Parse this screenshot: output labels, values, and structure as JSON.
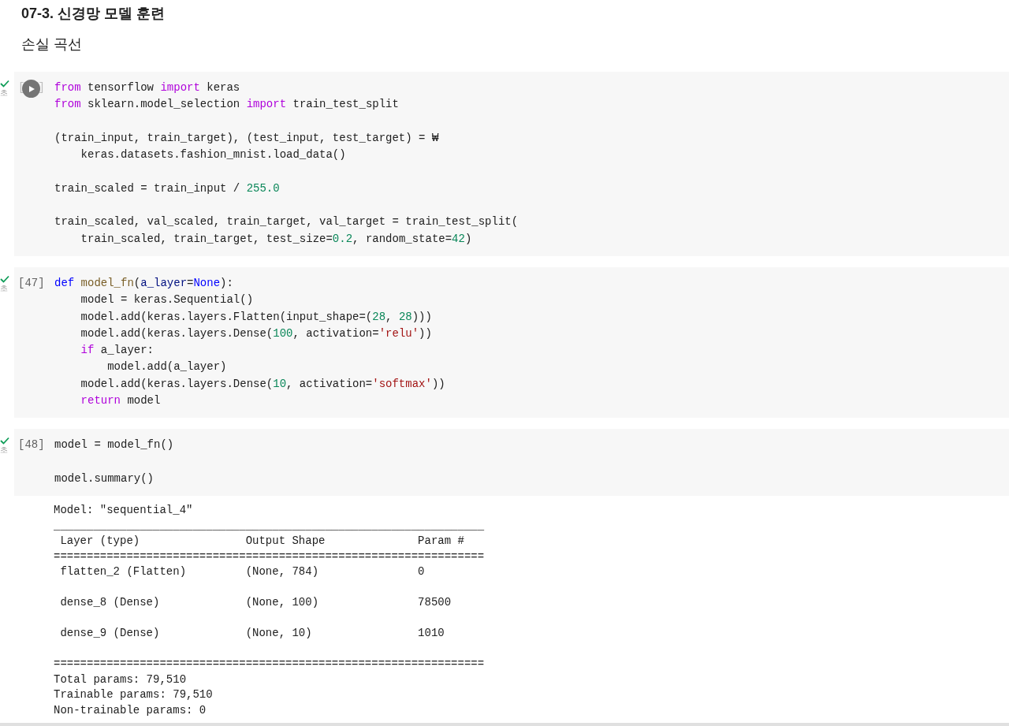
{
  "heading": "07-3. 신경망 모델 훈련",
  "subheading": "손실 곡선",
  "cells": [
    {
      "completed": true,
      "time": "초",
      "hover_run": true,
      "prompt_open": "[",
      "prompt_close": "]",
      "blocks": [
        [
          {
            "tokens": [
              {
                "text": "from",
                "kind": "keyword"
              },
              {
                "text": " tensorflow "
              },
              {
                "text": "import",
                "kind": "keyword"
              },
              {
                "text": " keras"
              }
            ]
          },
          {
            "tokens": [
              {
                "text": "from",
                "kind": "keyword"
              },
              {
                "text": " sklearn.model_selection "
              },
              {
                "text": "import",
                "kind": "keyword"
              },
              {
                "text": " train_test_split"
              }
            ]
          }
        ],
        [
          {
            "tokens": [
              {
                "text": "(train_input, train_target), (test_input, test_target) = ₩"
              }
            ],
            "children": [
              {
                "tokens": [
                  {
                    "text": "keras.datasets.fashion_mnist.load_data()"
                  }
                ]
              }
            ]
          }
        ],
        [
          {
            "tokens": [
              {
                "text": "train_scaled = train_input / "
              },
              {
                "text": "255.0",
                "kind": "number"
              }
            ]
          }
        ],
        [
          {
            "tokens": [
              {
                "text": "train_scaled, val_scaled, train_target, val_target = train_test_split("
              }
            ],
            "children": [
              {
                "tokens": [
                  {
                    "text": "train_scaled, train_target, test_size="
                  },
                  {
                    "text": "0.2",
                    "kind": "number"
                  },
                  {
                    "text": ", random_state="
                  },
                  {
                    "text": "42",
                    "kind": "number"
                  },
                  {
                    "text": ")"
                  }
                ]
              }
            ]
          }
        ]
      ]
    },
    {
      "completed": true,
      "time": "초",
      "hover_run": false,
      "prompt": "[47]",
      "blocks": [
        [
          {
            "tokens": [
              {
                "text": "def ",
                "kind": "storage"
              },
              {
                "text": "model_fn",
                "kind": "function"
              },
              {
                "text": "("
              },
              {
                "text": "a_layer",
                "kind": "parameter"
              },
              {
                "text": "="
              },
              {
                "text": "None",
                "kind": "storage"
              },
              {
                "text": "):"
              }
            ],
            "children": [
              {
                "tokens": [
                  {
                    "text": "model = keras.Sequential()"
                  }
                ]
              },
              {
                "tokens": [
                  {
                    "text": "model.add(keras.layers.Flatten(input_shape=("
                  },
                  {
                    "text": "28",
                    "kind": "number"
                  },
                  {
                    "text": ", "
                  },
                  {
                    "text": "28",
                    "kind": "number"
                  },
                  {
                    "text": ")))"
                  }
                ]
              },
              {
                "tokens": [
                  {
                    "text": "model.add(keras.layers.Dense("
                  },
                  {
                    "text": "100",
                    "kind": "number"
                  },
                  {
                    "text": ", activation="
                  },
                  {
                    "text": "'relu'",
                    "kind": "string"
                  },
                  {
                    "text": "))"
                  }
                ]
              },
              {
                "tokens": [
                  {
                    "text": "if",
                    "kind": "keyword"
                  },
                  {
                    "text": " a_layer:"
                  }
                ],
                "children": [
                  {
                    "tokens": [
                      {
                        "text": "model.add(a_layer)"
                      }
                    ]
                  }
                ]
              },
              {
                "tokens": [
                  {
                    "text": "model.add(keras.layers.Dense("
                  },
                  {
                    "text": "10",
                    "kind": "number"
                  },
                  {
                    "text": ", activation="
                  },
                  {
                    "text": "'softmax'",
                    "kind": "string"
                  },
                  {
                    "text": "))"
                  }
                ]
              },
              {
                "tokens": [
                  {
                    "text": "return",
                    "kind": "keyword"
                  },
                  {
                    "text": " model"
                  }
                ]
              }
            ]
          }
        ]
      ]
    },
    {
      "completed": true,
      "time": "초",
      "hover_run": false,
      "prompt": "[48]",
      "blocks": [
        [
          {
            "tokens": [
              {
                "text": "model = model_fn()"
              }
            ]
          }
        ],
        [
          {
            "tokens": [
              {
                "text": "model.summary()"
              }
            ]
          }
        ]
      ],
      "output": [
        [
          "Model: \"sequential_4\"",
          "_________________________________________________________________",
          " Layer (type)                Output Shape              Param #   ",
          "=================================================================",
          " flatten_2 (Flatten)         (None, 784)               0         "
        ],
        [
          " dense_8 (Dense)             (None, 100)               78500     "
        ],
        [
          " dense_9 (Dense)             (None, 10)                1010      "
        ],
        [
          "=================================================================",
          "Total params: 79,510",
          "Trainable params: 79,510",
          "Non-trainable params: 0"
        ]
      ]
    }
  ]
}
